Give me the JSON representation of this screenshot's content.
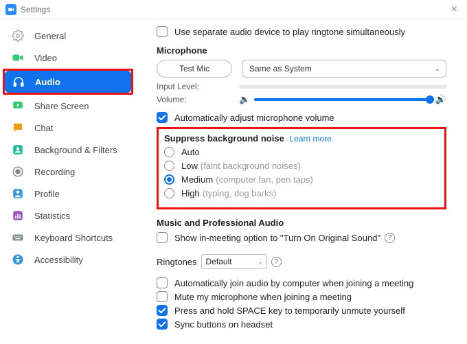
{
  "window": {
    "title": "Settings"
  },
  "sidebar": {
    "items": [
      {
        "label": "General"
      },
      {
        "label": "Video"
      },
      {
        "label": "Audio"
      },
      {
        "label": "Share Screen"
      },
      {
        "label": "Chat"
      },
      {
        "label": "Background & Filters"
      },
      {
        "label": "Recording"
      },
      {
        "label": "Profile"
      },
      {
        "label": "Statistics"
      },
      {
        "label": "Keyboard Shortcuts"
      },
      {
        "label": "Accessibility"
      }
    ]
  },
  "audio": {
    "separate_device_label": "Use separate audio device to play ringtone simultaneously",
    "microphone_heading": "Microphone",
    "test_mic_label": "Test Mic",
    "mic_device_selected": "Same as System",
    "input_level_label": "Input Level:",
    "volume_label": "Volume:",
    "auto_adjust_label": "Automatically adjust microphone volume",
    "noise": {
      "heading": "Suppress background noise",
      "learn_more": "Learn more",
      "options": {
        "auto": "Auto",
        "low": "Low",
        "low_hint": "(faint background noises)",
        "medium": "Medium",
        "medium_hint": "(computer fan, pen taps)",
        "high": "High",
        "high_hint": "(typing, dog barks)"
      }
    },
    "music_heading": "Music and Professional Audio",
    "original_sound_label": "Show in-meeting option to \"Turn On Original Sound\"",
    "ringtones_label": "Ringtones",
    "ringtone_selected": "Default",
    "auto_join_label": "Automatically join audio by computer when joining a meeting",
    "mute_on_join_label": "Mute my microphone when joining a meeting",
    "space_unmute_label": "Press and hold SPACE key to temporarily unmute yourself",
    "sync_headset_label": "Sync buttons on headset"
  }
}
